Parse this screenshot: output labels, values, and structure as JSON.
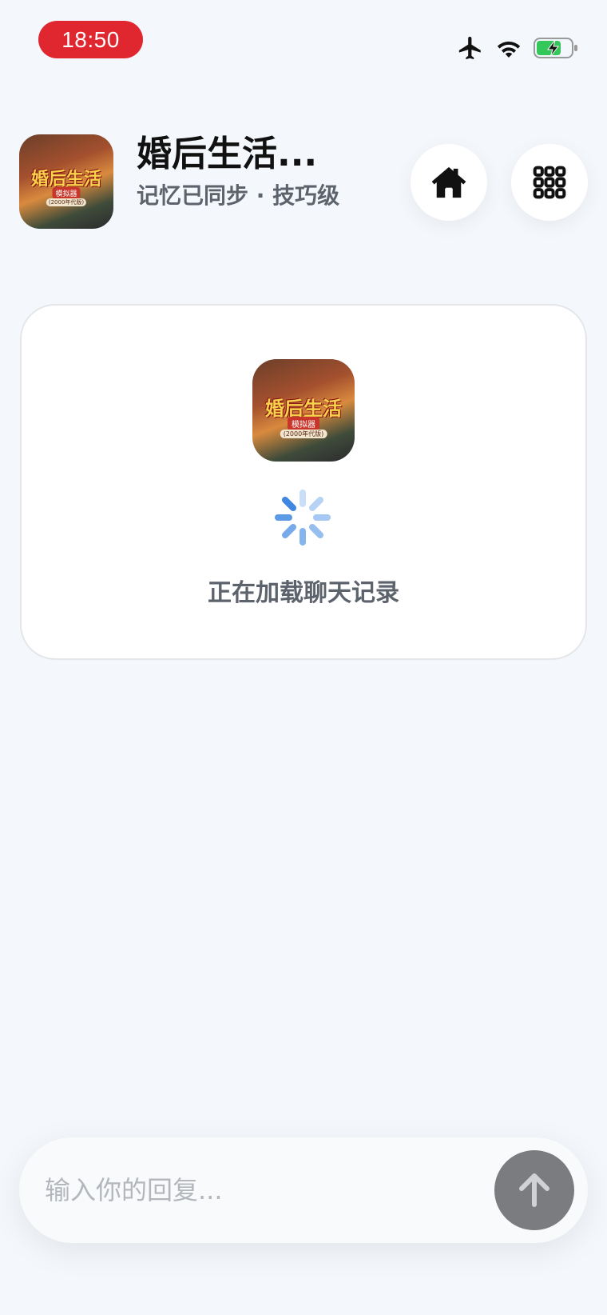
{
  "status_bar": {
    "time": "18:50",
    "accent_color": "#e0262f",
    "icons": [
      "airplane-icon",
      "wifi-icon",
      "battery-charging-icon"
    ]
  },
  "header": {
    "thumb": {
      "headline": "婚后生活",
      "badge": "模拟器",
      "subline": "(2000年代版)"
    },
    "title": "婚后生活...",
    "subtitle": "记忆已同步 · 技巧级",
    "buttons": {
      "home_icon": "home-icon",
      "apps_icon": "grid-icon"
    }
  },
  "loading": {
    "text": "正在加载聊天记录",
    "spinner_color": "#4a90e2"
  },
  "composer": {
    "placeholder": "输入你的回复...",
    "send_icon": "arrow-up-icon"
  }
}
